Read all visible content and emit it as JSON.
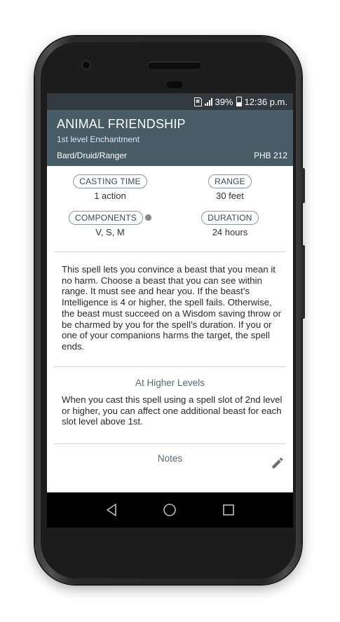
{
  "status_bar": {
    "battery": "39%",
    "time": "12:36 p.m."
  },
  "spell": {
    "name": "ANIMAL FRIENDSHIP",
    "level_school": "1st level Enchantment",
    "classes": "Bard/Druid/Ranger",
    "source": "PHB 212"
  },
  "stats": {
    "casting_time_label": "CASTING TIME",
    "casting_time_value": "1 action",
    "range_label": "RANGE",
    "range_value": "30 feet",
    "components_label": "COMPONENTS",
    "components_value": "V, S, M",
    "duration_label": "DURATION",
    "duration_value": "24 hours"
  },
  "description": "This spell lets you convince a beast that you mean it no harm. Choose a beast that you can see within range. It must see and hear you. If the beast’s Intelligence is 4 or higher, the spell fails. Otherwise, the beast must succeed on a Wisdom saving throw or be charmed by you for the spell’s duration. If you or one of your companions harms the target, the spell ends.",
  "higher_levels": {
    "title": "At Higher Levels",
    "text": "When you cast this spell using a spell slot of 2nd level or higher, you can affect one additional beast for each slot level above 1st."
  },
  "notes": {
    "title": "Notes"
  },
  "colors": {
    "app_bar": "#485c66",
    "status_bar": "#333a3f"
  }
}
